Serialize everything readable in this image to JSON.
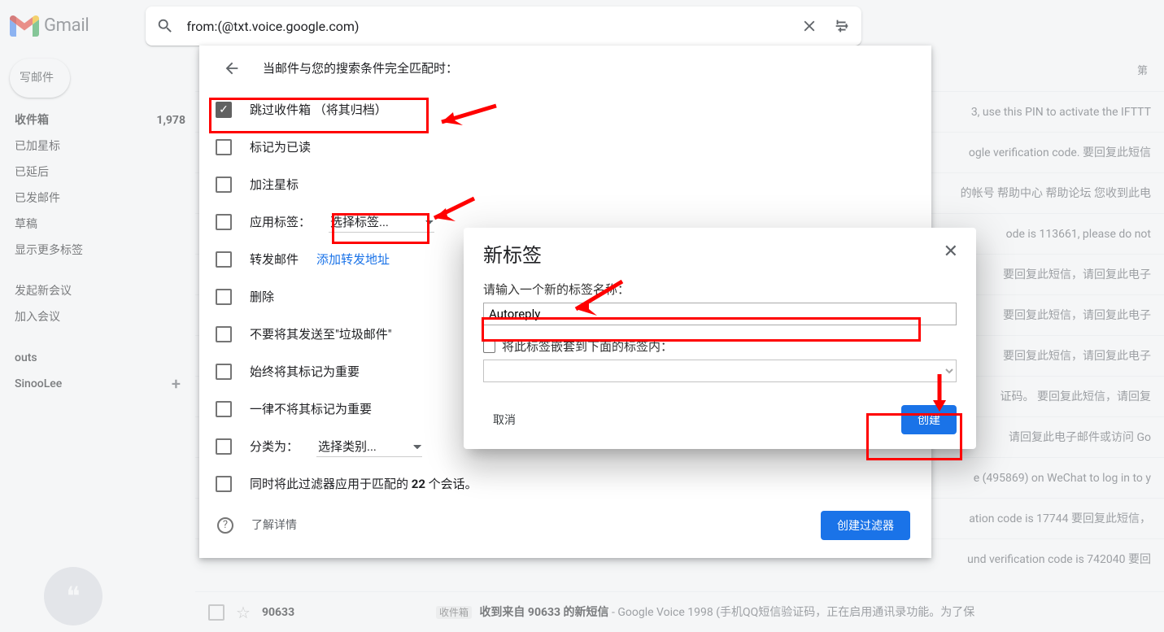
{
  "header": {
    "logo_text": "Gmail",
    "search_value": "from:(@txt.voice.google.com)"
  },
  "sidebar": {
    "compose": "写邮件",
    "items": [
      {
        "label": "收件箱",
        "count": "1,978",
        "bold": true
      },
      {
        "label": "已加星标"
      },
      {
        "label": "已延后"
      },
      {
        "label": "已发邮件"
      },
      {
        "label": "草稿"
      },
      {
        "label": "显示更多标签"
      }
    ],
    "meet_head": "",
    "meet": [
      {
        "label": "发起新会议"
      },
      {
        "label": "加入会议"
      }
    ],
    "hangouts_head": "outs",
    "user": "SinooLee"
  },
  "toolbar": {
    "right_hint": "第"
  },
  "filter": {
    "head": "当邮件与您的搜索条件完全匹配时：",
    "opts": [
      {
        "label": "跳过收件箱 （将其归档）",
        "checked": true
      },
      {
        "label": "标记为已读"
      },
      {
        "label": "加注星标"
      }
    ],
    "apply_label": "应用标签：",
    "apply_label_sel": "选择标签...",
    "forward": "转发邮件",
    "forward_link": "添加转发地址",
    "more": [
      {
        "label": "删除"
      },
      {
        "label": "不要将其发送至\"垃圾邮件\""
      },
      {
        "label": "始终将其标记为重要"
      },
      {
        "label": "一律不将其标记为重要"
      }
    ],
    "categorize": "分类为：",
    "categorize_sel": "选择类别...",
    "also_before": "同时将此过滤器应用于匹配的 ",
    "also_num": "22",
    "also_after": " 个会话。",
    "learn": "了解详情",
    "create": "创建过滤器"
  },
  "dialog": {
    "title": "新标签",
    "prompt": "请输入一个新的标签名称：",
    "value": "Autoreply",
    "nest": "将此标签嵌套到下面的标签内：",
    "cancel": "取消",
    "create": "创建"
  },
  "rows": [
    {
      "snip": "3, use this PIN to activate the IFTTT"
    },
    {
      "snip": "ogle verification code. 要回复此短信"
    },
    {
      "snip": "的帐号 帮助中心 帮助论坛 您收到此电"
    },
    {
      "snip": "ode is 113661, please do not"
    },
    {
      "snip": "要回复此短信，请回复此电子"
    },
    {
      "snip": "要回复此短信，请回复此电子"
    },
    {
      "snip": "要回复此短信，请回复此电子"
    },
    {
      "snip": "证码。 要回复此短信，请回复"
    },
    {
      "snip": "请回复此电子邮件或访问 Go"
    },
    {
      "snip": "e (495869) on WeChat to log in to y"
    },
    {
      "snip": "ation code is 17744 要回复此短信，"
    },
    {
      "snip": "und verification code is 742040 要回"
    }
  ],
  "bottom_row": {
    "from": "90633",
    "tag": "收件箱",
    "subject": "收到来自 90633 的新短信",
    "snip": " - Google Voice 1998 (手机QQ短信验证码，正在启用通讯录功能。为了保"
  }
}
